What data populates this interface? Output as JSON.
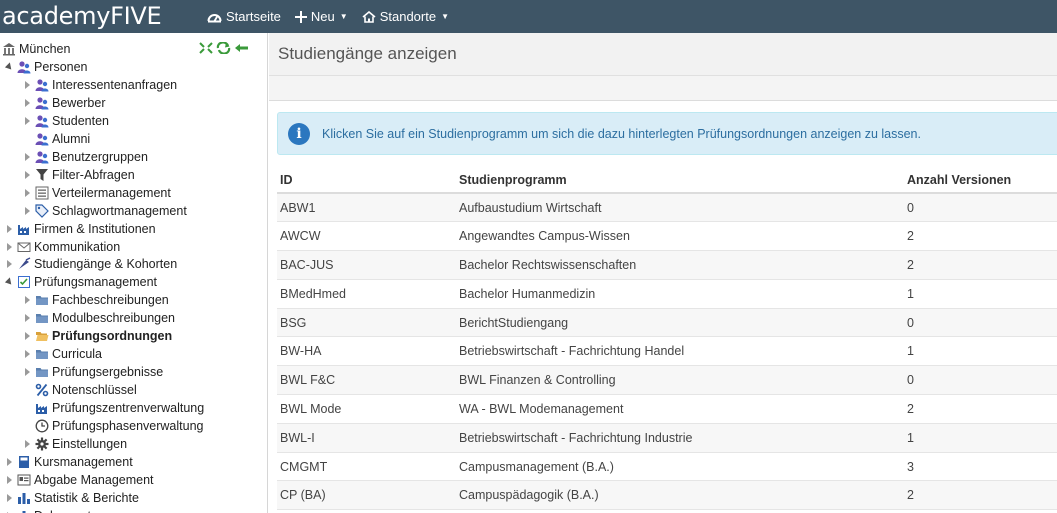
{
  "app": {
    "logo_text": "academyFIVE"
  },
  "nav": {
    "home_label": "Startseite",
    "new_label": "Neu",
    "locations_label": "Standorte"
  },
  "sidebar": {
    "root_label": "München",
    "items": [
      {
        "label": "Personen",
        "icon": "persons-icon",
        "level": 1,
        "toggle": "open"
      },
      {
        "label": "Interessentenanfragen",
        "icon": "persons-icon",
        "level": 2,
        "toggle": "closed"
      },
      {
        "label": "Bewerber",
        "icon": "persons-icon",
        "level": 2,
        "toggle": "closed"
      },
      {
        "label": "Studenten",
        "icon": "persons-icon",
        "level": 2,
        "toggle": "closed"
      },
      {
        "label": "Alumni",
        "icon": "persons-icon",
        "level": 2,
        "toggle": "none"
      },
      {
        "label": "Benutzergruppen",
        "icon": "persons-icon",
        "level": 2,
        "toggle": "closed"
      },
      {
        "label": "Filter-Abfragen",
        "icon": "filter-icon",
        "level": 2,
        "toggle": "closed"
      },
      {
        "label": "Verteilermanagement",
        "icon": "list-icon",
        "level": 2,
        "toggle": "closed"
      },
      {
        "label": "Schlagwortmanagement",
        "icon": "tag-icon",
        "level": 2,
        "toggle": "closed"
      },
      {
        "label": "Firmen & Institutionen",
        "icon": "factory-icon",
        "level": 1,
        "toggle": "closed"
      },
      {
        "label": "Kommunikation",
        "icon": "envelope-icon",
        "level": 1,
        "toggle": "closed"
      },
      {
        "label": "Studiengänge & Kohorten",
        "icon": "graduation-icon",
        "level": 1,
        "toggle": "closed"
      },
      {
        "label": "Prüfungsmanagement",
        "icon": "checklist-icon",
        "level": 1,
        "toggle": "open"
      },
      {
        "label": "Fachbeschreibungen",
        "icon": "folder-icon",
        "level": 2,
        "toggle": "closed"
      },
      {
        "label": "Modulbeschreibungen",
        "icon": "folder-icon",
        "level": 2,
        "toggle": "closed"
      },
      {
        "label": "Prüfungsordnungen",
        "icon": "folder-open-icon",
        "level": 2,
        "toggle": "closed",
        "active": true
      },
      {
        "label": "Curricula",
        "icon": "folder-icon",
        "level": 2,
        "toggle": "closed"
      },
      {
        "label": "Prüfungsergebnisse",
        "icon": "folder-icon",
        "level": 2,
        "toggle": "closed"
      },
      {
        "label": "Notenschlüssel",
        "icon": "percent-icon",
        "level": 2,
        "toggle": "none"
      },
      {
        "label": "Prüfungszentrenverwaltung",
        "icon": "factory-icon",
        "level": 2,
        "toggle": "none"
      },
      {
        "label": "Prüfungsphasenverwaltung",
        "icon": "clock-icon",
        "level": 2,
        "toggle": "none"
      },
      {
        "label": "Einstellungen",
        "icon": "gear-icon",
        "level": 2,
        "toggle": "closed"
      },
      {
        "label": "Kursmanagement",
        "icon": "book-icon",
        "level": 1,
        "toggle": "closed"
      },
      {
        "label": "Abgabe Management",
        "icon": "card-icon",
        "level": 1,
        "toggle": "closed"
      },
      {
        "label": "Statistik & Berichte",
        "icon": "bar-chart-icon",
        "level": 1,
        "toggle": "closed"
      },
      {
        "label": "Dokumente",
        "icon": "bar-chart-icon",
        "level": 1,
        "toggle": "closed"
      }
    ]
  },
  "main": {
    "title": "Studiengänge anzeigen",
    "info_message": "Klicken Sie auf ein Studienprogramm um sich die dazu hinterlegten Prüfungsordnungen anzeigen zu lassen.",
    "columns": [
      "ID",
      "Studienprogramm",
      "Anzahl Versionen"
    ],
    "rows": [
      [
        "ABW1",
        "Aufbaustudium Wirtschaft",
        "0"
      ],
      [
        "AWCW",
        "Angewandtes Campus-Wissen",
        "2"
      ],
      [
        "BAC-JUS",
        "Bachelor Rechtswissenschaften",
        "2"
      ],
      [
        "BMedHmed",
        "Bachelor Humanmedizin",
        "1"
      ],
      [
        "BSG",
        "BerichtStudiengang",
        "0"
      ],
      [
        "BW-HA",
        "Betriebswirtschaft - Fachrichtung Handel",
        "1"
      ],
      [
        "BWL F&C",
        "BWL Finanzen & Controlling",
        "0"
      ],
      [
        "BWL Mode",
        "WA - BWL Modemanagement",
        "2"
      ],
      [
        "BWL-I",
        "Betriebswirtschaft - Fachrichtung Industrie",
        "1"
      ],
      [
        "CMGMT",
        "Campusmanagement (B.A.)",
        "3"
      ],
      [
        "CP (BA)",
        "Campuspädagogik (B.A.)",
        "2"
      ]
    ]
  }
}
